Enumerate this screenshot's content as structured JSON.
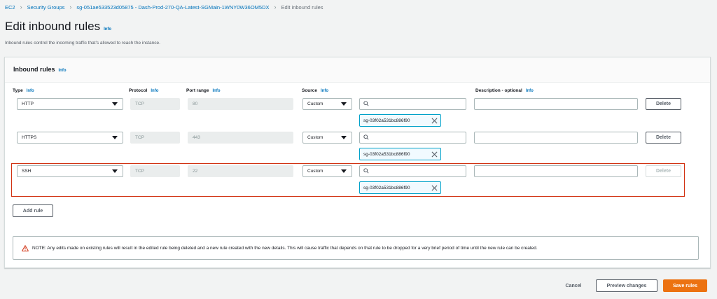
{
  "breadcrumb": {
    "items": [
      "EC2",
      "Security Groups",
      "sg-051ae533523d05875 - Dash-Prod-270-QA-Latest-SGMain-1WNY0W36OM5DX",
      "Edit inbound rules"
    ]
  },
  "page": {
    "title": "Edit inbound rules",
    "title_info": "Info",
    "description": "Inbound rules control the incoming traffic that's allowed to reach the instance."
  },
  "panel": {
    "title": "Inbound rules",
    "info": "Info"
  },
  "columns": {
    "type": "Type",
    "protocol": "Protocol",
    "port_range": "Port range",
    "source": "Source",
    "description": "Description - optional",
    "info": "Info"
  },
  "rules": [
    {
      "type": "HTTP",
      "protocol": "TCP",
      "port_range": "80",
      "source": "Custom",
      "search_value": "",
      "token": "sg-03f02a531bc886f90",
      "description": "",
      "delete_label": "Delete",
      "delete_enabled": true
    },
    {
      "type": "HTTPS",
      "protocol": "TCP",
      "port_range": "443",
      "source": "Custom",
      "search_value": "",
      "token": "sg-03f02a531bc886f90",
      "description": "",
      "delete_label": "Delete",
      "delete_enabled": true
    },
    {
      "type": "SSH",
      "protocol": "TCP",
      "port_range": "22",
      "source": "Custom",
      "search_value": "",
      "token": "sg-03f02a531bc886f90",
      "description": "",
      "delete_label": "Delete",
      "delete_enabled": false
    }
  ],
  "add_rule_label": "Add rule",
  "alert": {
    "text": "NOTE: Any edits made on existing rules will result in the edited rule being deleted and a new rule created with the new details. This will cause traffic that depends on that rule to be dropped for a very brief period of time until the new rule can be created.",
    "icon": "warning-icon"
  },
  "footer": {
    "cancel_label": "Cancel",
    "preview_label": "Preview changes",
    "save_label": "Save rules"
  },
  "colors": {
    "primary_button": "#ec7211",
    "link": "#0073bb",
    "highlight": "#d13212",
    "token_border": "#00a1c9"
  }
}
